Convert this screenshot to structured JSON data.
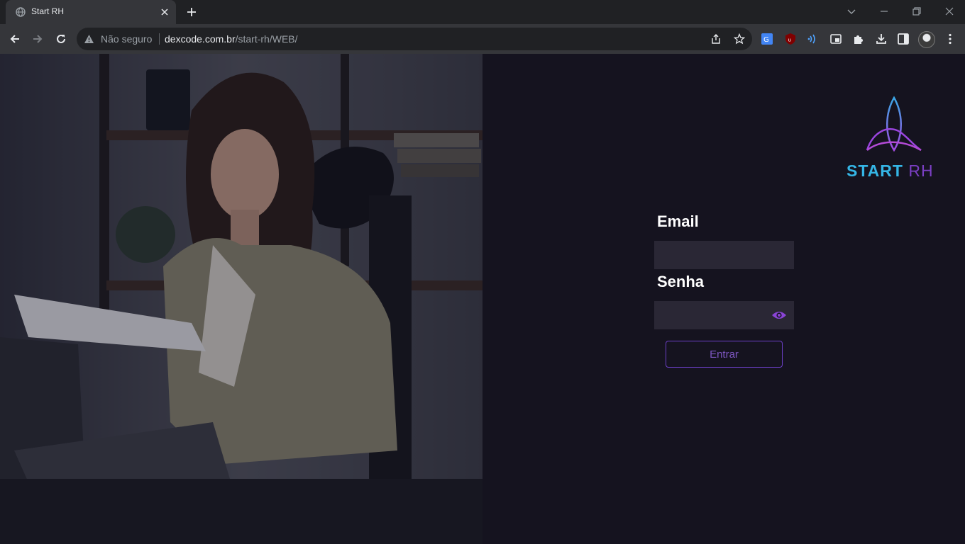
{
  "browser": {
    "tab": {
      "title": "Start RH"
    },
    "omnibox": {
      "security_label": "Não seguro",
      "url_host": "dexcode.com.br",
      "url_path": "/start-rh/WEB/"
    }
  },
  "brand": {
    "name_primary": "START",
    "name_secondary": "RH",
    "colors": {
      "primary": "#35b6e6",
      "secondary": "#7b3fc4",
      "accent": "#6c3fc7",
      "background": "#15131f"
    }
  },
  "login": {
    "email_label": "Email",
    "email_value": "",
    "password_label": "Senha",
    "password_value": "",
    "submit_label": "Entrar"
  },
  "icons": {
    "tab": [
      "globe-icon",
      "close-icon"
    ],
    "toolbar": [
      "back-icon",
      "forward-icon",
      "reload-icon",
      "warning-icon",
      "share-icon",
      "star-icon"
    ],
    "extensions": [
      "translate-icon",
      "ublock-icon",
      "wave-icon",
      "media-icon",
      "puzzle-icon",
      "download-icon",
      "sidepanel-icon",
      "avatar",
      "menu-icon"
    ],
    "form": [
      "eye-icon"
    ]
  }
}
